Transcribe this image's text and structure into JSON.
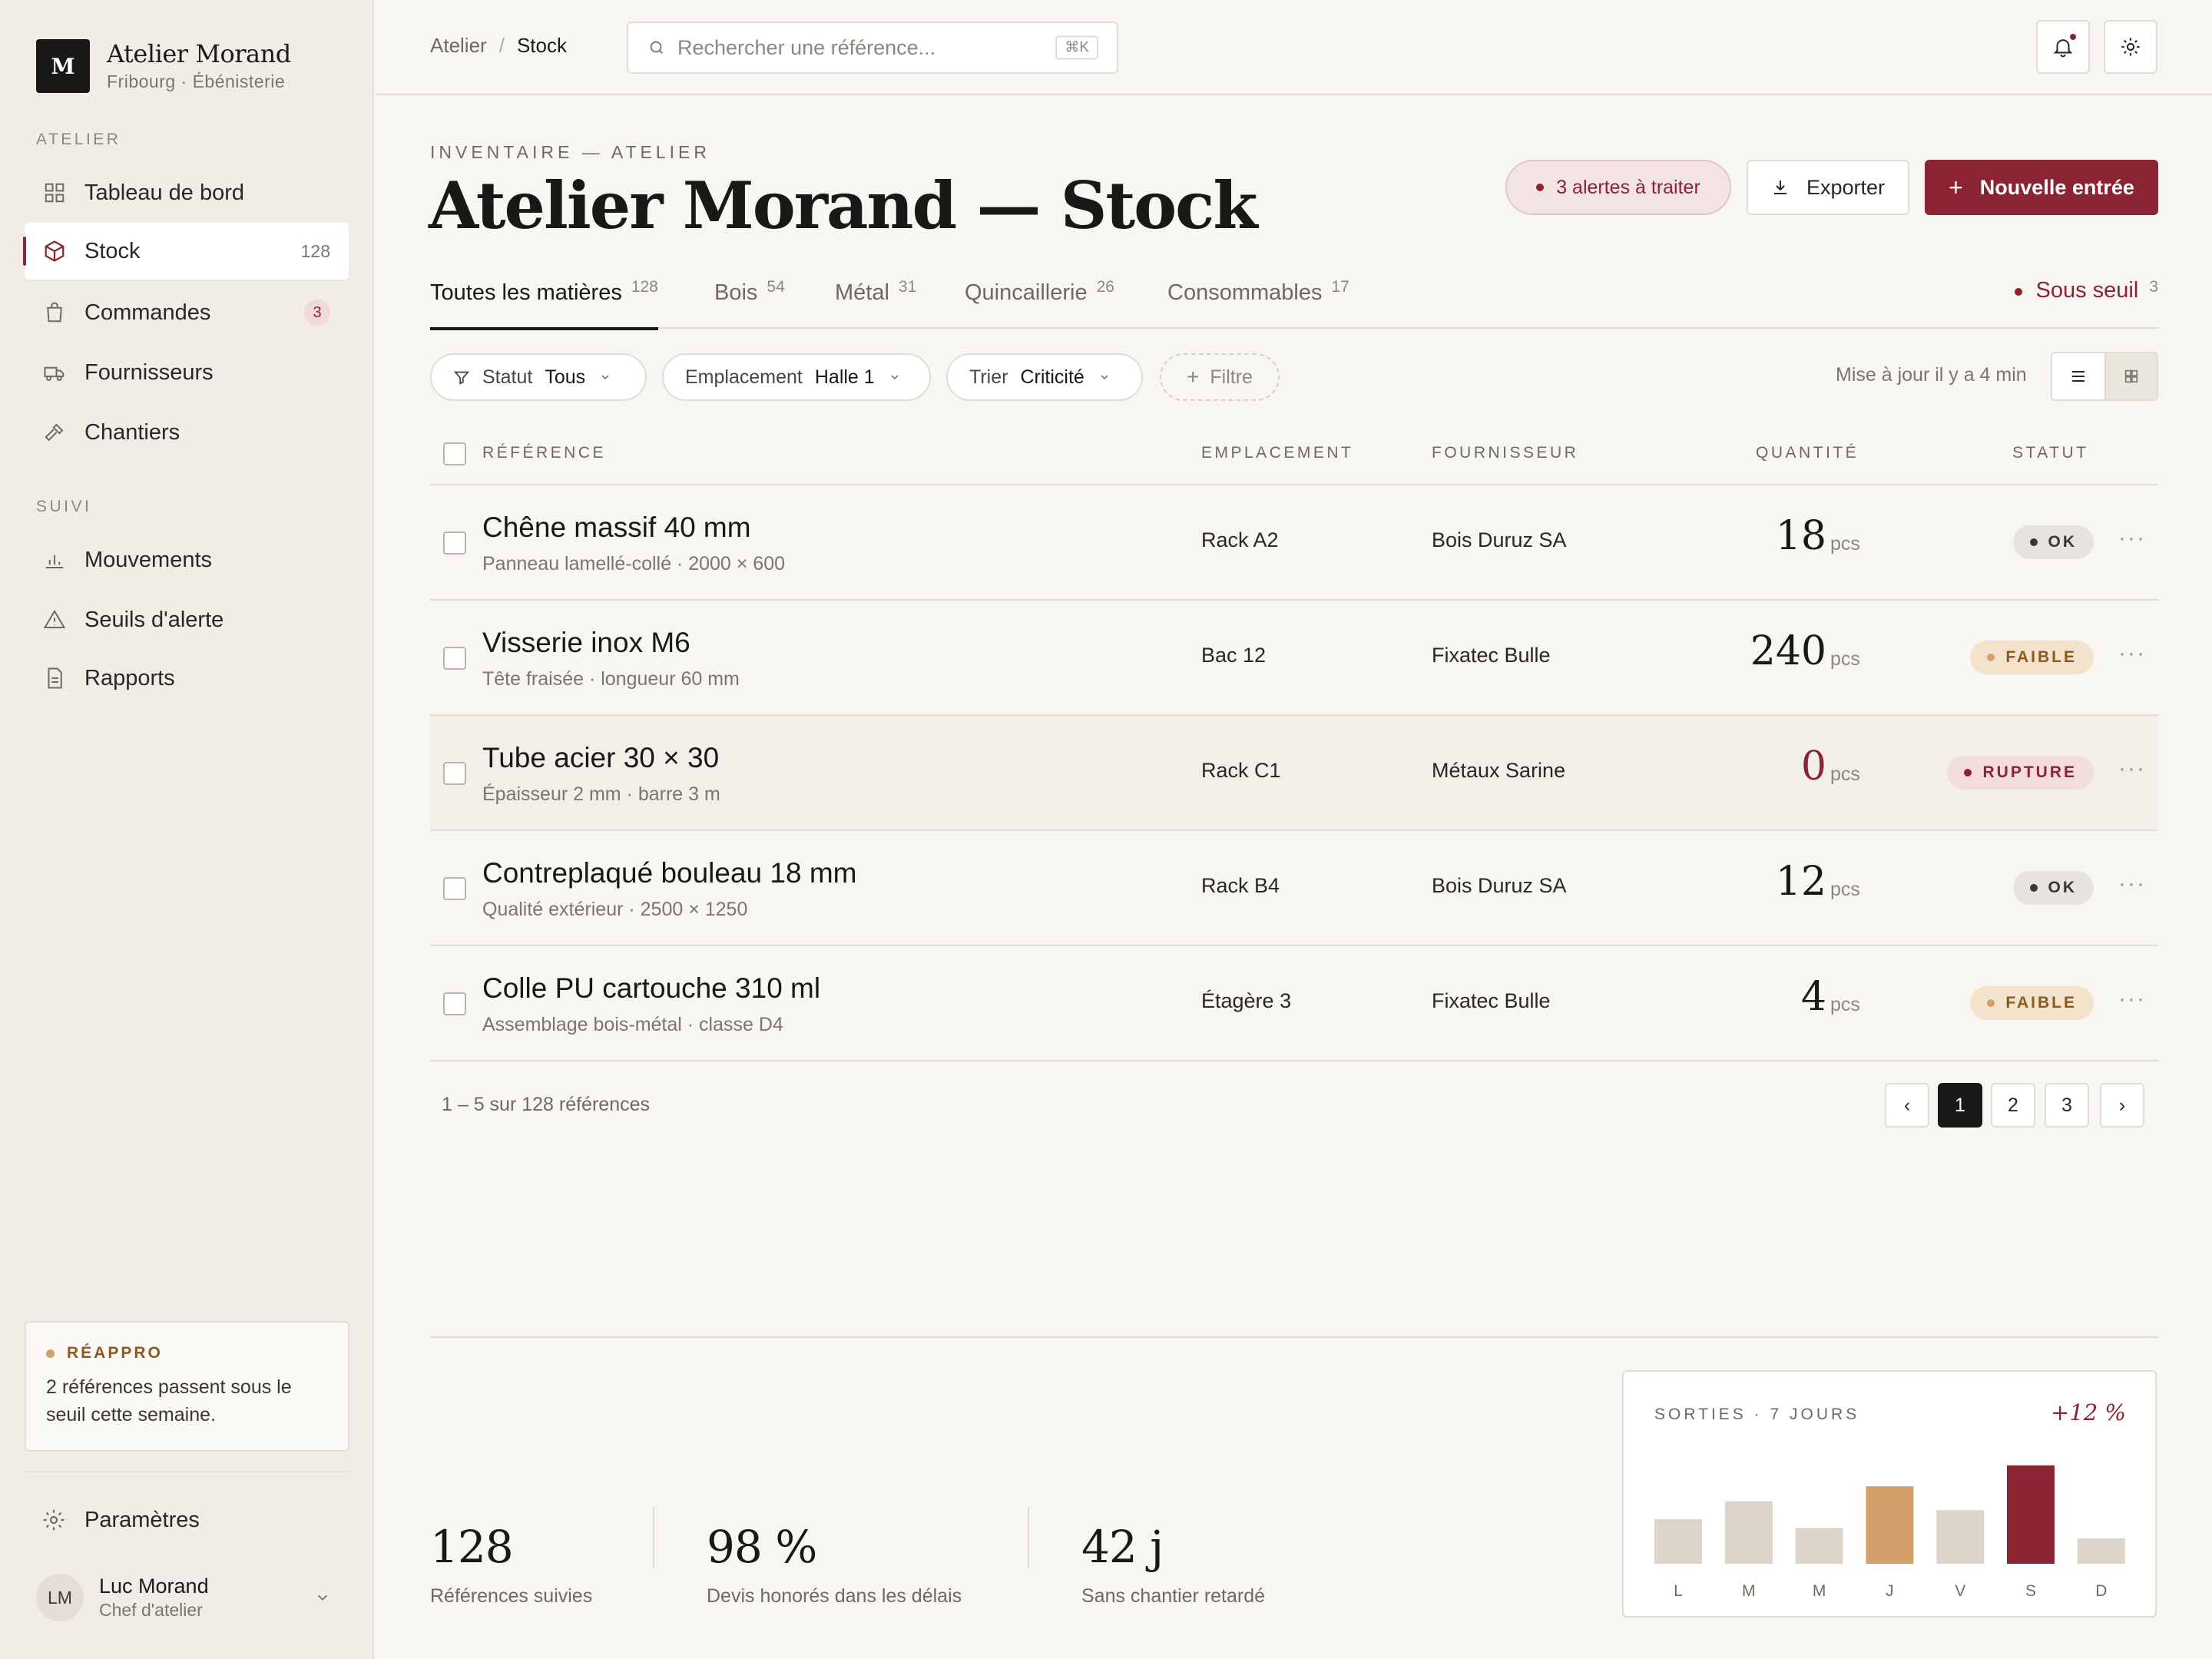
{
  "brand": {
    "initial": "M",
    "name": "Atelier Morand",
    "subtitle": "Fribourg · Ébénisterie"
  },
  "sidebar": {
    "section_atelier": "ATELIER",
    "section_suivi": "SUIVI",
    "items": [
      {
        "label": "Tableau de bord",
        "icon": "grid-icon"
      },
      {
        "label": "Stock",
        "icon": "box-icon",
        "count": "128",
        "active": true
      },
      {
        "label": "Commandes",
        "icon": "bag-icon",
        "badge": "3"
      },
      {
        "label": "Fournisseurs",
        "icon": "truck-icon"
      },
      {
        "label": "Chantiers",
        "icon": "hammer-icon"
      },
      {
        "label": "Mouvements",
        "icon": "bar-chart-icon"
      },
      {
        "label": "Seuils d'alerte",
        "icon": "warning-icon"
      },
      {
        "label": "Rapports",
        "icon": "document-icon"
      }
    ],
    "reappro": {
      "title": "RÉAPPRO",
      "text": "2 références passent sous le seuil cette semaine."
    },
    "settings": "Paramètres",
    "user": {
      "initials": "LM",
      "name": "Luc Morand",
      "role": "Chef d'atelier"
    }
  },
  "topbar": {
    "breadcrumb": [
      "Atelier",
      "Stock"
    ],
    "breadcrumb_sep": "/",
    "search_placeholder": "Rechercher une référence...",
    "search_shortcut": "⌘K"
  },
  "header": {
    "eyebrow": "INVENTAIRE — ATELIER",
    "title": "Atelier Morand — Stock",
    "alerts": "3 alertes à traiter",
    "export": "Exporter",
    "new_entry": "Nouvelle entrée"
  },
  "tabs": [
    {
      "label": "Toutes les matières",
      "count": "128",
      "active": true
    },
    {
      "label": "Bois",
      "count": "54"
    },
    {
      "label": "Métal",
      "count": "31"
    },
    {
      "label": "Quincaillerie",
      "count": "26"
    },
    {
      "label": "Consommables",
      "count": "17"
    }
  ],
  "threshold_tab": {
    "label": "Sous seuil",
    "count": "3"
  },
  "filters": [
    {
      "label": "Statut",
      "value": "Tous"
    },
    {
      "label": "Emplacement",
      "value": "Halle 1"
    },
    {
      "label": "Trier",
      "value": "Criticité"
    }
  ],
  "add_filter": "Filtre",
  "updated": "Mise à jour il y a 4 min",
  "table": {
    "columns": [
      "RÉFÉRENCE",
      "EMPLACEMENT",
      "FOURNISSEUR",
      "QUANTITÉ",
      "STATUT"
    ],
    "rows": [
      {
        "ref": "Chêne massif 40 mm",
        "sub": "Panneau lamellé-collé · 2000 × 600",
        "loc": "Rack A2",
        "supplier": "Bois Duruz SA",
        "qty": "18",
        "unit": "pcs",
        "status": "OK",
        "status_kind": "ok"
      },
      {
        "ref": "Visserie inox M6",
        "sub": "Tête fraisée · longueur 60 mm",
        "loc": "Bac 12",
        "supplier": "Fixatec Bulle",
        "qty": "240",
        "unit": "pcs",
        "status": "FAIBLE",
        "status_kind": "faible"
      },
      {
        "ref": "Tube acier 30 × 30",
        "sub": "Épaisseur 2 mm · barre 3 m",
        "loc": "Rack C1",
        "supplier": "Métaux Sarine",
        "qty": "0",
        "unit": "pcs",
        "status": "RUPTURE",
        "status_kind": "rupture"
      },
      {
        "ref": "Contreplaqué bouleau 18 mm",
        "sub": "Qualité extérieur · 2500 × 1250",
        "loc": "Rack B4",
        "supplier": "Bois Duruz SA",
        "qty": "12",
        "unit": "pcs",
        "status": "OK",
        "status_kind": "ok"
      },
      {
        "ref": "Colle PU cartouche 310 ml",
        "sub": "Assemblage bois-métal · classe D4",
        "loc": "Étagère 3",
        "supplier": "Fixatec Bulle",
        "qty": "4",
        "unit": "pcs",
        "status": "FAIBLE",
        "status_kind": "faible"
      }
    ],
    "more_icon": "···"
  },
  "pagination": {
    "info": "1 – 5 sur 128 références",
    "pages": [
      "1",
      "2",
      "3"
    ],
    "prev": "‹",
    "next": "›"
  },
  "stats": [
    {
      "value": "128",
      "label": "Références suivies"
    },
    {
      "value": "98 %",
      "label": "Devis honorés dans les délais"
    },
    {
      "value": "42 j",
      "label": "Sans chantier retardé"
    }
  ],
  "colors": {
    "accent": "#8c2333",
    "amber": "#d4a06a",
    "neutral_bar": "#ddd5ca"
  },
  "chart_data": {
    "type": "bar",
    "title": "SORTIES · 7 JOURS",
    "delta": "+12 %",
    "categories": [
      "L",
      "M",
      "M",
      "J",
      "V",
      "S",
      "D"
    ],
    "values": [
      30,
      42,
      24,
      52,
      36,
      66,
      17
    ],
    "highlight": {
      "3": "amber",
      "5": "accent"
    }
  }
}
